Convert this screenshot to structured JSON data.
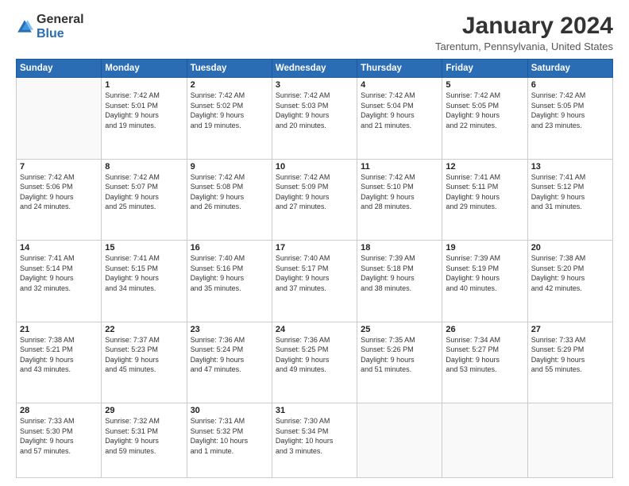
{
  "header": {
    "logo_general": "General",
    "logo_blue": "Blue",
    "month_title": "January 2024",
    "location": "Tarentum, Pennsylvania, United States"
  },
  "days_of_week": [
    "Sunday",
    "Monday",
    "Tuesday",
    "Wednesday",
    "Thursday",
    "Friday",
    "Saturday"
  ],
  "weeks": [
    [
      {
        "day": "",
        "info": ""
      },
      {
        "day": "1",
        "info": "Sunrise: 7:42 AM\nSunset: 5:01 PM\nDaylight: 9 hours\nand 19 minutes."
      },
      {
        "day": "2",
        "info": "Sunrise: 7:42 AM\nSunset: 5:02 PM\nDaylight: 9 hours\nand 19 minutes."
      },
      {
        "day": "3",
        "info": "Sunrise: 7:42 AM\nSunset: 5:03 PM\nDaylight: 9 hours\nand 20 minutes."
      },
      {
        "day": "4",
        "info": "Sunrise: 7:42 AM\nSunset: 5:04 PM\nDaylight: 9 hours\nand 21 minutes."
      },
      {
        "day": "5",
        "info": "Sunrise: 7:42 AM\nSunset: 5:05 PM\nDaylight: 9 hours\nand 22 minutes."
      },
      {
        "day": "6",
        "info": "Sunrise: 7:42 AM\nSunset: 5:05 PM\nDaylight: 9 hours\nand 23 minutes."
      }
    ],
    [
      {
        "day": "7",
        "info": "Sunrise: 7:42 AM\nSunset: 5:06 PM\nDaylight: 9 hours\nand 24 minutes."
      },
      {
        "day": "8",
        "info": "Sunrise: 7:42 AM\nSunset: 5:07 PM\nDaylight: 9 hours\nand 25 minutes."
      },
      {
        "day": "9",
        "info": "Sunrise: 7:42 AM\nSunset: 5:08 PM\nDaylight: 9 hours\nand 26 minutes."
      },
      {
        "day": "10",
        "info": "Sunrise: 7:42 AM\nSunset: 5:09 PM\nDaylight: 9 hours\nand 27 minutes."
      },
      {
        "day": "11",
        "info": "Sunrise: 7:42 AM\nSunset: 5:10 PM\nDaylight: 9 hours\nand 28 minutes."
      },
      {
        "day": "12",
        "info": "Sunrise: 7:41 AM\nSunset: 5:11 PM\nDaylight: 9 hours\nand 29 minutes."
      },
      {
        "day": "13",
        "info": "Sunrise: 7:41 AM\nSunset: 5:12 PM\nDaylight: 9 hours\nand 31 minutes."
      }
    ],
    [
      {
        "day": "14",
        "info": "Sunrise: 7:41 AM\nSunset: 5:14 PM\nDaylight: 9 hours\nand 32 minutes."
      },
      {
        "day": "15",
        "info": "Sunrise: 7:41 AM\nSunset: 5:15 PM\nDaylight: 9 hours\nand 34 minutes."
      },
      {
        "day": "16",
        "info": "Sunrise: 7:40 AM\nSunset: 5:16 PM\nDaylight: 9 hours\nand 35 minutes."
      },
      {
        "day": "17",
        "info": "Sunrise: 7:40 AM\nSunset: 5:17 PM\nDaylight: 9 hours\nand 37 minutes."
      },
      {
        "day": "18",
        "info": "Sunrise: 7:39 AM\nSunset: 5:18 PM\nDaylight: 9 hours\nand 38 minutes."
      },
      {
        "day": "19",
        "info": "Sunrise: 7:39 AM\nSunset: 5:19 PM\nDaylight: 9 hours\nand 40 minutes."
      },
      {
        "day": "20",
        "info": "Sunrise: 7:38 AM\nSunset: 5:20 PM\nDaylight: 9 hours\nand 42 minutes."
      }
    ],
    [
      {
        "day": "21",
        "info": "Sunrise: 7:38 AM\nSunset: 5:21 PM\nDaylight: 9 hours\nand 43 minutes."
      },
      {
        "day": "22",
        "info": "Sunrise: 7:37 AM\nSunset: 5:23 PM\nDaylight: 9 hours\nand 45 minutes."
      },
      {
        "day": "23",
        "info": "Sunrise: 7:36 AM\nSunset: 5:24 PM\nDaylight: 9 hours\nand 47 minutes."
      },
      {
        "day": "24",
        "info": "Sunrise: 7:36 AM\nSunset: 5:25 PM\nDaylight: 9 hours\nand 49 minutes."
      },
      {
        "day": "25",
        "info": "Sunrise: 7:35 AM\nSunset: 5:26 PM\nDaylight: 9 hours\nand 51 minutes."
      },
      {
        "day": "26",
        "info": "Sunrise: 7:34 AM\nSunset: 5:27 PM\nDaylight: 9 hours\nand 53 minutes."
      },
      {
        "day": "27",
        "info": "Sunrise: 7:33 AM\nSunset: 5:29 PM\nDaylight: 9 hours\nand 55 minutes."
      }
    ],
    [
      {
        "day": "28",
        "info": "Sunrise: 7:33 AM\nSunset: 5:30 PM\nDaylight: 9 hours\nand 57 minutes."
      },
      {
        "day": "29",
        "info": "Sunrise: 7:32 AM\nSunset: 5:31 PM\nDaylight: 9 hours\nand 59 minutes."
      },
      {
        "day": "30",
        "info": "Sunrise: 7:31 AM\nSunset: 5:32 PM\nDaylight: 10 hours\nand 1 minute."
      },
      {
        "day": "31",
        "info": "Sunrise: 7:30 AM\nSunset: 5:34 PM\nDaylight: 10 hours\nand 3 minutes."
      },
      {
        "day": "",
        "info": ""
      },
      {
        "day": "",
        "info": ""
      },
      {
        "day": "",
        "info": ""
      }
    ]
  ]
}
